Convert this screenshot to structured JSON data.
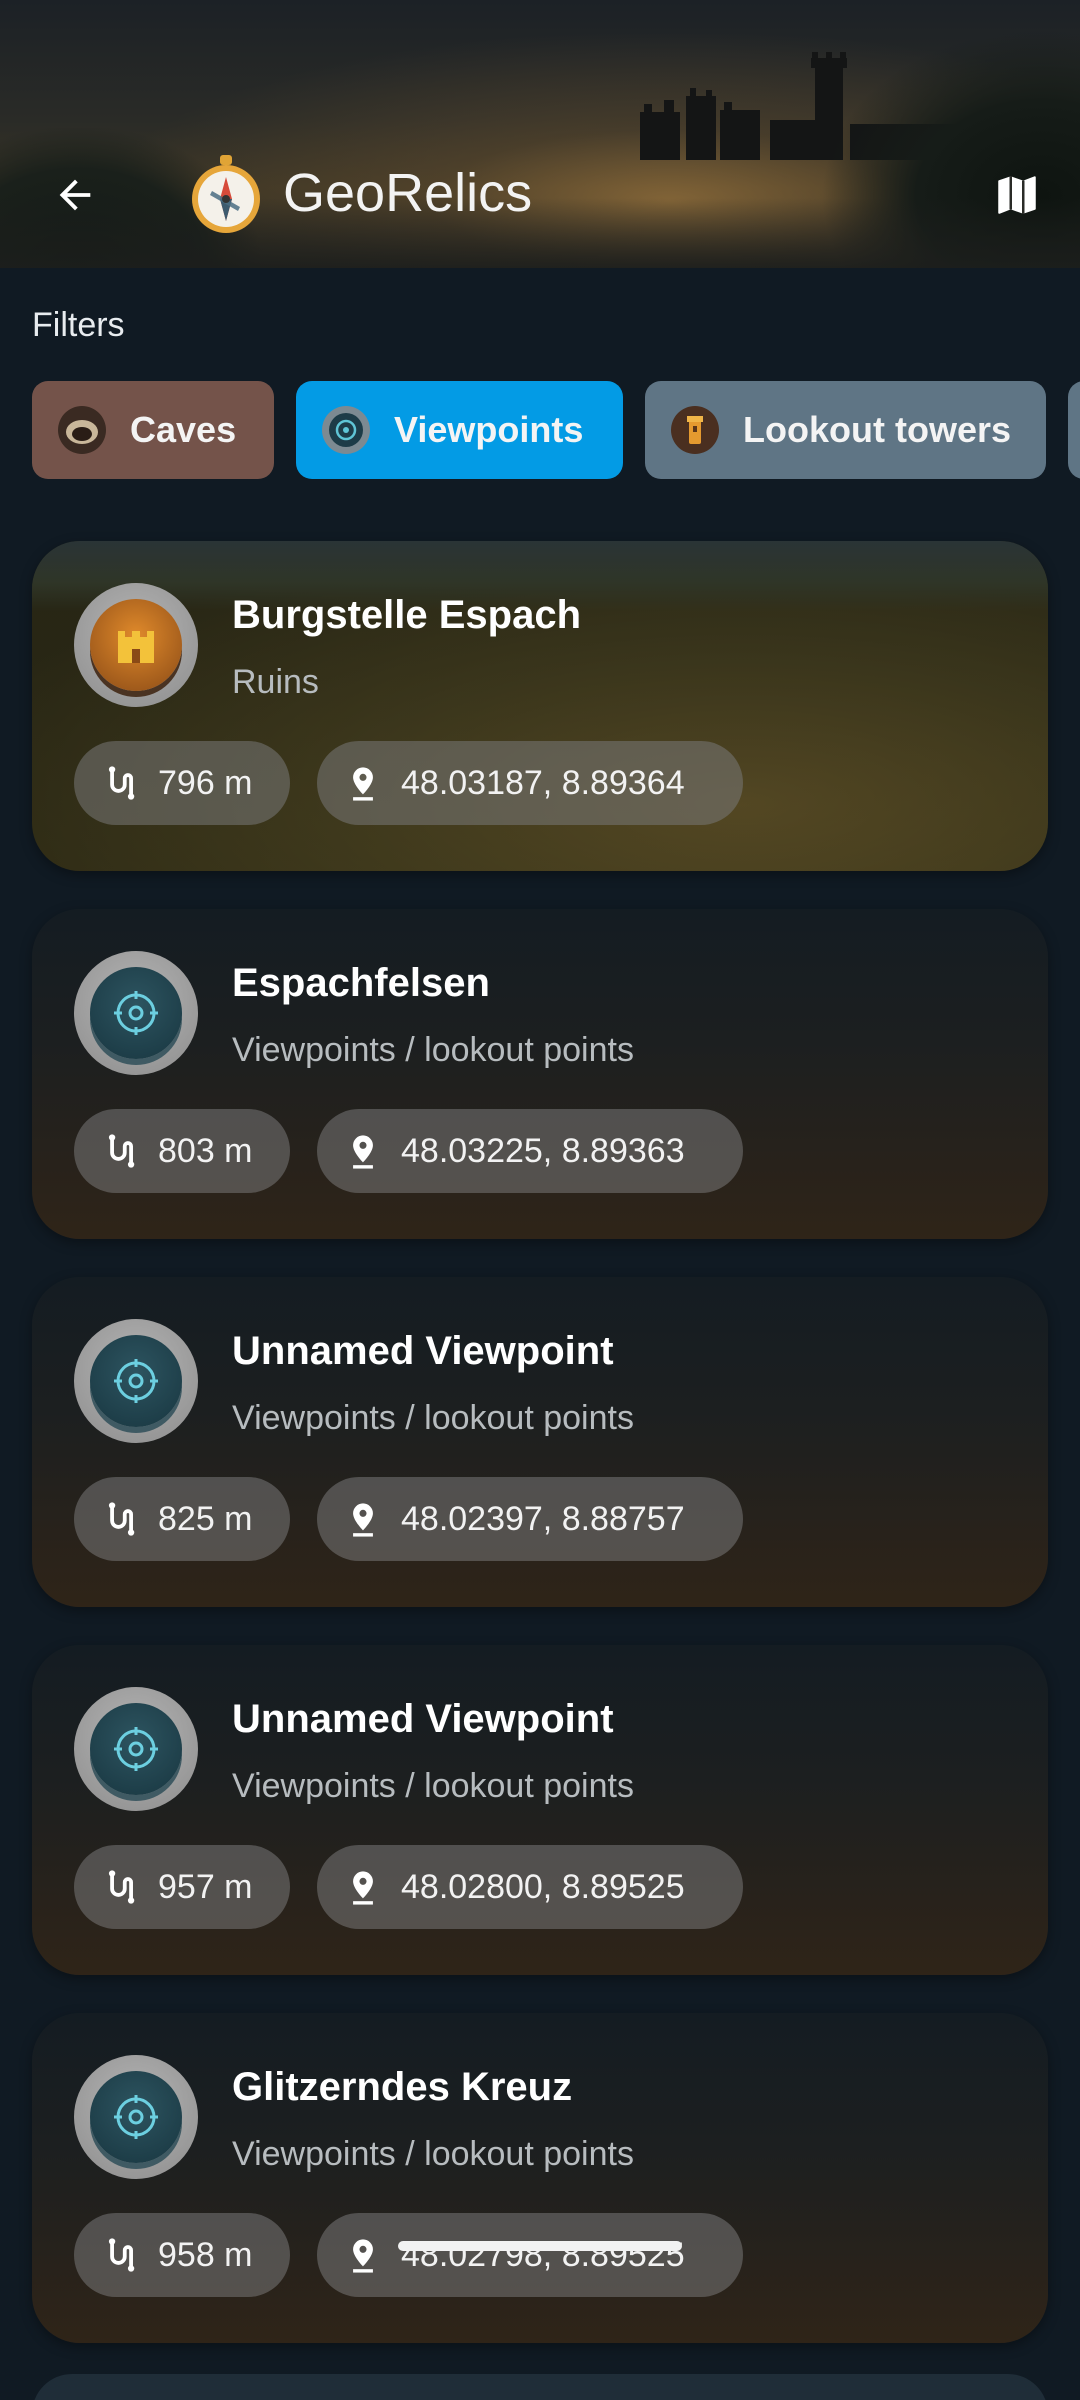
{
  "header": {
    "title": "GeoRelics",
    "back_icon": "arrow-left-icon",
    "logo_icon": "compass-icon",
    "map_icon": "map-icon"
  },
  "filters": {
    "label": "Filters",
    "chips": [
      {
        "label": "Caves",
        "icon": "cave-icon",
        "color": "#74534a",
        "selected": false
      },
      {
        "label": "Viewpoints",
        "icon": "viewpoint-icon",
        "color": "#039be5",
        "selected": true
      },
      {
        "label": "Lookout towers",
        "icon": "lookout-tower-icon",
        "color": "#5f7585",
        "selected": false
      }
    ]
  },
  "places": [
    {
      "title": "Burgstelle Espach",
      "category": "Ruins",
      "distance": "796 m",
      "coords": "48.03187, 8.89364",
      "icon": "castle-icon"
    },
    {
      "title": "Espachfelsen",
      "category": "Viewpoints / lookout points",
      "distance": "803 m",
      "coords": "48.03225, 8.89363",
      "icon": "viewpoint-icon"
    },
    {
      "title": "Unnamed Viewpoint",
      "category": "Viewpoints / lookout points",
      "distance": "825 m",
      "coords": "48.02397, 8.88757",
      "icon": "viewpoint-icon"
    },
    {
      "title": "Unnamed Viewpoint",
      "category": "Viewpoints / lookout points",
      "distance": "957 m",
      "coords": "48.02800, 8.89525",
      "icon": "viewpoint-icon"
    },
    {
      "title": "Glitzerndes Kreuz",
      "category": "Viewpoints / lookout points",
      "distance": "958 m",
      "coords": "48.02798, 8.89525",
      "icon": "viewpoint-icon"
    }
  ],
  "colors": {
    "accent": "#039be5",
    "background": "#101a23"
  }
}
